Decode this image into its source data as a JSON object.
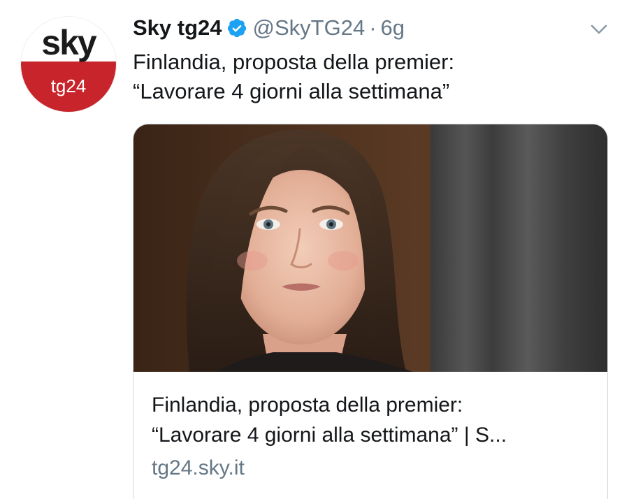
{
  "avatar": {
    "logo_top": "sky",
    "logo_bottom": "tg24",
    "brand_red": "#c8242b"
  },
  "header": {
    "display_name": "Sky tg24",
    "verified_icon": "verified-badge-icon",
    "handle": "@SkyTG24",
    "separator": "·",
    "time": "6g",
    "menu_icon": "chevron-down-icon"
  },
  "tweet": {
    "text_line1": "Finlandia, proposta della premier:",
    "text_line2": "“Lavorare 4 giorni alla settimana”"
  },
  "card": {
    "image_icon": "portrait-photo",
    "title_line1": "Finlandia, proposta della premier:",
    "title_line2": "“Lavorare 4 giorni alla settimana” | S...",
    "domain": "tg24.sky.it"
  },
  "colors": {
    "text": "#14171a",
    "secondary_text": "#657786",
    "verified_blue": "#1da1f2",
    "card_border": "#cfd9de"
  }
}
